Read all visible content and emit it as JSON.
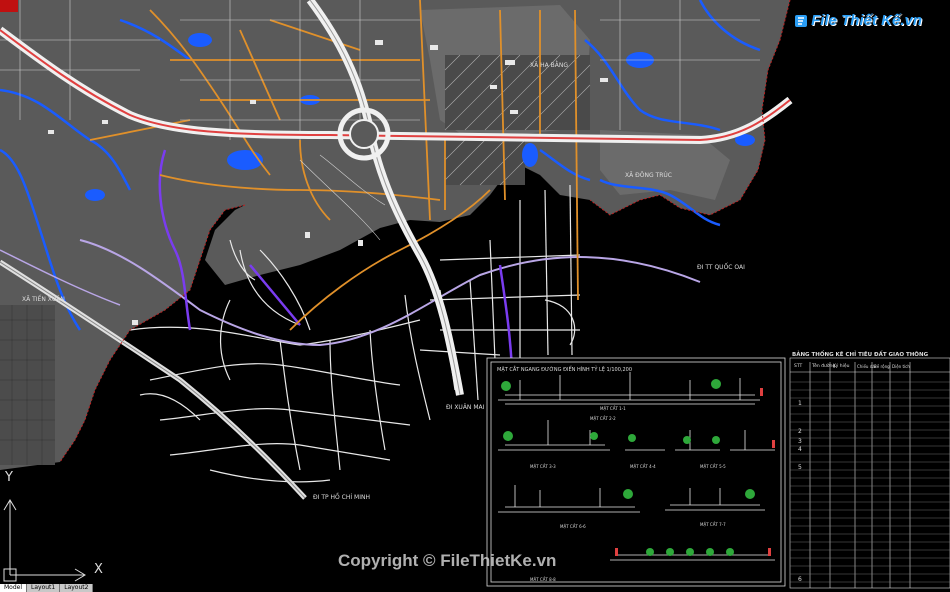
{
  "map": {
    "labels": {
      "la_ha_bang": "XÃ HẠ BẰNG",
      "dong_truc": "XÃ ĐÔNG TRÚC",
      "tien_xuan": "XÃ TIẾN XUÂN",
      "quoc_oai": "ĐI TT QUỐC OAI",
      "xuan_mai": "ĐI XUÂN MAI",
      "ho_chi_minh": "ĐI TP HỒ CHÍ MINH"
    }
  },
  "logo": {
    "text": "File Thiết Kế.vn"
  },
  "watermark": {
    "text": "Copyright © FileThietKe.vn"
  },
  "sections_panel": {
    "title": "MẶT CẮT NGANG ĐƯỜNG ĐIỂN HÌNH TỶ LỆ 1/100,200",
    "captions": [
      "MẶT CẮT 1-1",
      "MẶT CẮT 2-2",
      "MẶT CẮT 3-3",
      "MẶT CẮT 4-4",
      "MẶT CẮT 5-5",
      "MẶT CẮT 6-6",
      "MẶT CẮT 7-7",
      "MẶT CẮT 8-8"
    ]
  },
  "table": {
    "title": "BẢNG THỐNG KÊ CHỈ TIÊU ĐẤT GIAO THÔNG",
    "headers": [
      "STT",
      "Tên đường",
      "Ký hiệu",
      "Chiều dài",
      "Bề rộng",
      "Diện tích"
    ],
    "row_numbers": [
      "1",
      "2",
      "3",
      "4",
      "5",
      "6"
    ]
  },
  "ucs": {
    "x": "X",
    "y": "Y"
  },
  "layout_tabs": [
    "Model",
    "Layout1",
    "Layout2"
  ],
  "colors": {
    "background": "#000000",
    "land": "#5a5a5a",
    "water": "#1a5cff",
    "highway": "#e04040",
    "orange_road": "#e0902a",
    "purple_road": "#7a3cf0",
    "lilac_road": "#b9a6e6"
  }
}
